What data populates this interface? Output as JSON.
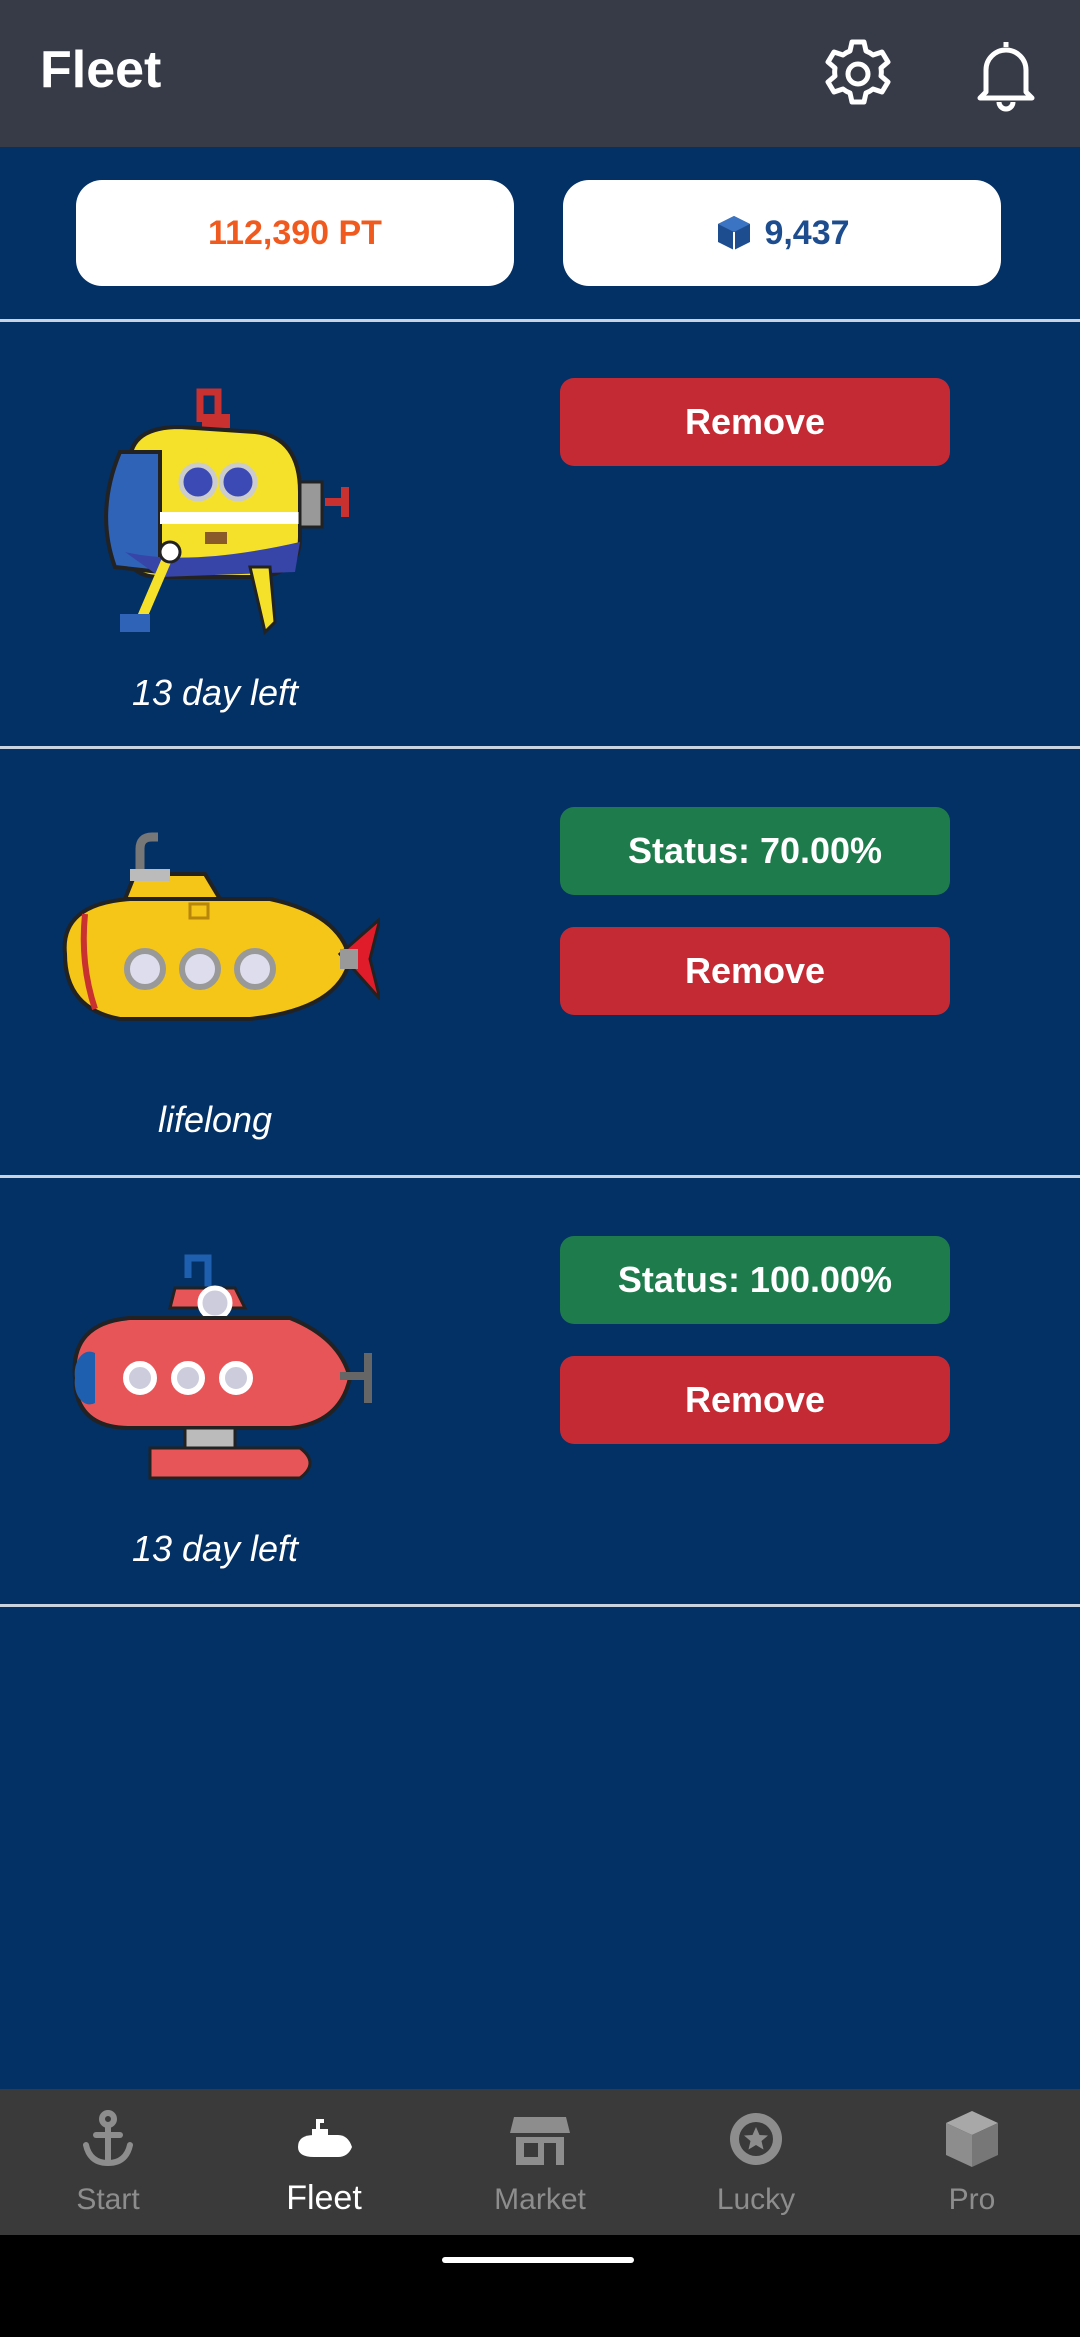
{
  "header": {
    "title": "Fleet",
    "icons": [
      "gear-icon",
      "bell-icon"
    ]
  },
  "balances": {
    "points": "112,390 PT",
    "cubes": "9,437",
    "cube_icon": "cube-icon"
  },
  "fleet": [
    {
      "name": "yellow-robot-submarine",
      "label": "13 day left",
      "status": "",
      "remove_label": "Remove"
    },
    {
      "name": "yellow-classic-submarine",
      "label": "lifelong",
      "status": "Status: 70.00%",
      "remove_label": "Remove"
    },
    {
      "name": "red-submarine",
      "label": "13 day left",
      "status": "Status: 100.00%",
      "remove_label": "Remove"
    }
  ],
  "tabs": [
    {
      "label": "Start",
      "icon": "anchor-icon"
    },
    {
      "label": "Fleet",
      "icon": "submarine-icon",
      "active": true
    },
    {
      "label": "Market",
      "icon": "store-icon"
    },
    {
      "label": "Lucky",
      "icon": "roulette-icon"
    },
    {
      "label": "Pro",
      "icon": "cube-icon"
    }
  ],
  "colors": {
    "background": "#033065",
    "appbar": "#363b47",
    "remove": "#c42a34",
    "status": "#1e7b4c",
    "points_text": "#f05a1e",
    "cubes_text": "#1d4d8e",
    "tabbar": "#3a3a3a"
  }
}
